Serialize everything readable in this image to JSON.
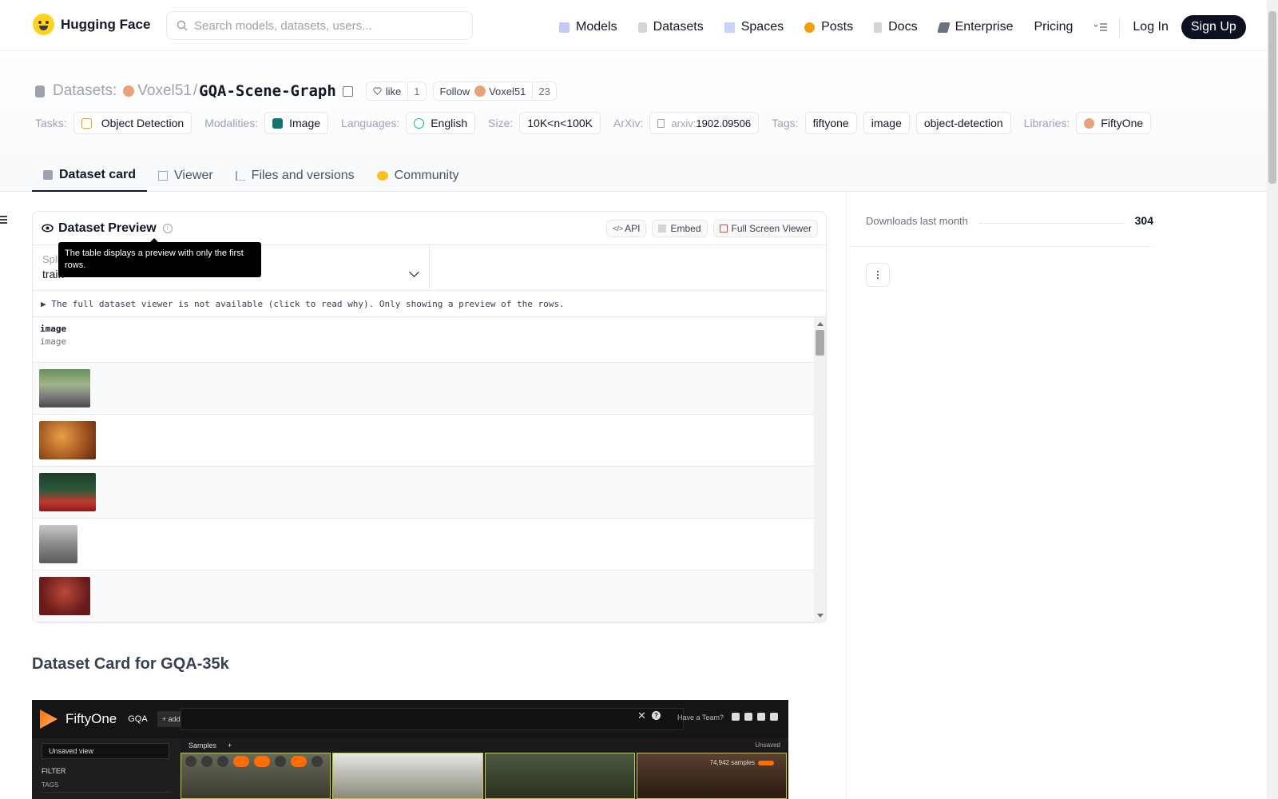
{
  "nav": {
    "brand": "Hugging Face",
    "search_placeholder": "Search models, datasets, users...",
    "items": [
      {
        "label": "Models",
        "icon": "models-icon",
        "color": "#a5b4fc"
      },
      {
        "label": "Datasets",
        "icon": "datasets-icon",
        "color": "#d1d5db"
      },
      {
        "label": "Spaces",
        "icon": "spaces-icon",
        "color": "#c7d2fe"
      },
      {
        "label": "Posts",
        "icon": "posts-icon",
        "color": "#f59e0b"
      },
      {
        "label": "Docs",
        "icon": "docs-icon",
        "color": "#d1d5db"
      },
      {
        "label": "Enterprise",
        "icon": "enterprise-icon",
        "color": "#6b7280"
      },
      {
        "label": "Pricing",
        "icon": "",
        "color": ""
      }
    ],
    "login": "Log In",
    "signup": "Sign Up"
  },
  "header": {
    "crumb_label": "Datasets:",
    "org": "Voxel51",
    "slash": "/",
    "repo": "GQA-Scene-Graph",
    "like_label": "like",
    "like_count": "1",
    "follow_label": "Follow",
    "follow_org": "Voxel51",
    "follow_count": "23"
  },
  "tags": {
    "tasks_label": "Tasks:",
    "task": "Object Detection",
    "modalities_label": "Modalities:",
    "modality": "Image",
    "languages_label": "Languages:",
    "language": "English",
    "size_label": "Size:",
    "size": "10K<n<100K",
    "arxiv_label": "ArXiv:",
    "arxiv_prefix": "arxiv:",
    "arxiv_id": "1902.09506",
    "tags_label": "Tags:",
    "tag_items": [
      "fiftyone",
      "image",
      "object-detection"
    ],
    "libraries_label": "Libraries:",
    "library": "FiftyOne"
  },
  "tabs": [
    {
      "label": "Dataset card",
      "active": true
    },
    {
      "label": "Viewer",
      "active": false
    },
    {
      "label": "Files and versions",
      "active": false
    },
    {
      "label": "Community",
      "active": false
    }
  ],
  "preview": {
    "title": "Dataset Preview",
    "tooltip": "The table displays a preview with only the first rows.",
    "api_label": "API",
    "embed_label": "Embed",
    "fullscreen_label": "Full Screen Viewer",
    "split_label": "Split",
    "split_value": "train",
    "notice": "▶ The full dataset viewer is not available (click to read why). Only showing a preview of the rows.",
    "column_name": "image",
    "column_type": "image"
  },
  "card": {
    "heading": "Dataset Card for GQA-35k"
  },
  "fiftyone": {
    "name": "FiftyOne",
    "dataset": "GQA",
    "add_stage": "+ add stage",
    "have_team": "Have a Team?",
    "view": "Unsaved view",
    "filter": "FILTER",
    "tags": "TAGS",
    "samples_tab": "Samples",
    "unsaved": "Unsaved",
    "sample_count": "74,942 samples"
  },
  "sidebar": {
    "downloads_label": "Downloads last month",
    "downloads_value": "304"
  }
}
